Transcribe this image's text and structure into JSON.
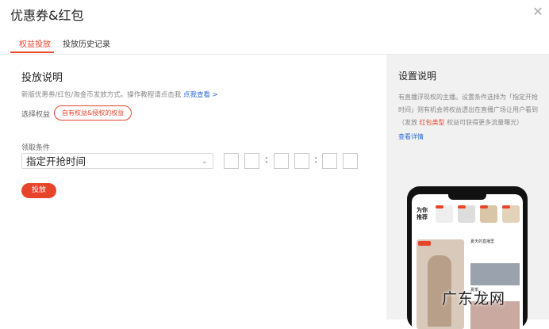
{
  "dialog": {
    "title": "优惠券&红包",
    "close_icon": "close-icon"
  },
  "tabs": [
    {
      "label": "权益投放"
    },
    {
      "label": "投放历史记录"
    }
  ],
  "left": {
    "section_title": "投放说明",
    "description": "新版优惠券/红包/淘金币发放方式。操作教程请点击我",
    "description_link": "点我查看 >",
    "select_benefit_label": "选择权益",
    "benefit_chip": "自有权益&授权的权益",
    "condition_label": "领取条件",
    "condition_select": "指定开抢时间",
    "time_separator": ":",
    "submit_button": "投放"
  },
  "right": {
    "title": "设置说明",
    "text_before": "有直播浮现权的主播。设置条件选择为「指定开抢时间」则有机会将权益透出在直播广场让用户看到（发放",
    "text_red": "红包类型",
    "text_after": "权益可获得更多流量曝光）",
    "link": "查看详情",
    "phone": {
      "feature_label": "为你\n推荐",
      "card_text_1": "夏天的直播里",
      "card_text_2": "夏季..."
    }
  },
  "watermark": "广东龙网",
  "colors": {
    "accent": "#e8442a",
    "link": "#2b6bd6",
    "panel": "#f1f1f1"
  }
}
